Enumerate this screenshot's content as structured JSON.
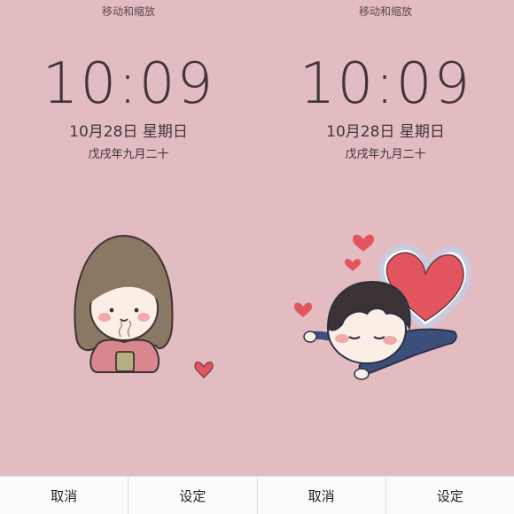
{
  "panels": [
    {
      "hint": "移动和缩放",
      "time": "10:09",
      "date": "10月28日  星期日",
      "lunar": "戊戌年九月二十"
    },
    {
      "hint": "移动和缩放",
      "time": "10:09",
      "date": "10月28日  星期日",
      "lunar": "戊戌年九月二十"
    }
  ],
  "buttons": [
    {
      "label": "取消"
    },
    {
      "label": "设定"
    },
    {
      "label": "取消"
    },
    {
      "label": "设定"
    }
  ],
  "colors": {
    "wallpaper": "#e3bcc1",
    "text": "#3f3538",
    "heart": "#e2555f",
    "bar": "#fbfbfb"
  }
}
